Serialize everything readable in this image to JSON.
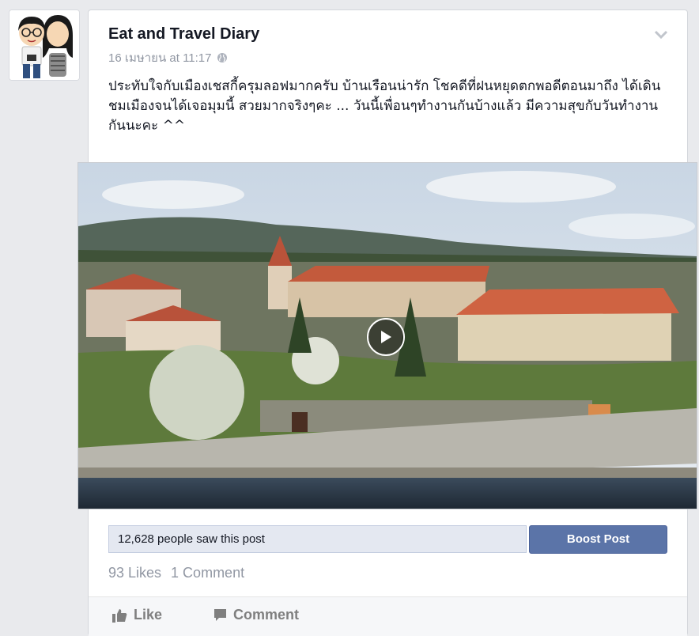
{
  "page": {
    "name": "Eat and Travel Diary",
    "timestamp": "16 เมษายน at 11:17",
    "audience_icon": "globe-icon",
    "options_icon": "chevron-down-icon"
  },
  "post": {
    "text": "ประทับใจกับเมืองเชสกี้ครุมลอฟมากครับ บ้านเรือนน่ารัก โชคดีที่ฝนหยุดตกพอดีตอนมาถึง ได้เดินชมเมืองจนได้เจอมุมนี้ สวยมากจริงๆคะ ... วันนี้เพื่อนๆทำงานกันบ้างแล้ว มีความสุขกับวันทำงานกันนะคะ ^^"
  },
  "video": {
    "play_icon": "play-icon"
  },
  "insights": {
    "reach": "12,628 people saw this post",
    "boost_label": "Boost Post"
  },
  "stats": {
    "likes": "93 Likes",
    "comments": "1 Comment"
  },
  "actions": {
    "like_label": "Like",
    "comment_label": "Comment"
  }
}
